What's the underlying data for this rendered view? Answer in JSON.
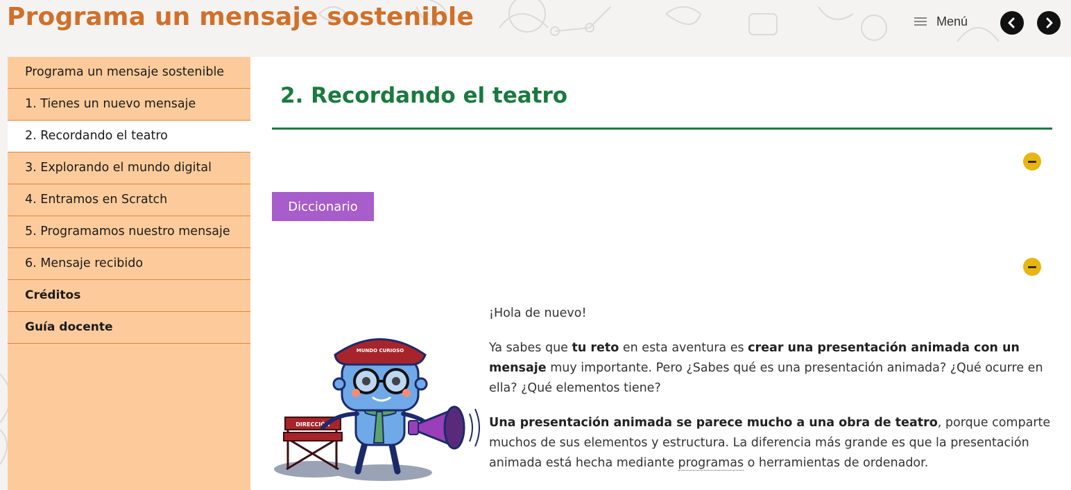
{
  "header": {
    "title": "Programa un mensaje sostenible",
    "menu_label": "Menú",
    "menu_icon": "hamburger-icon",
    "prev_icon": "chevron-left-icon",
    "next_icon": "chevron-right-icon"
  },
  "sidebar": {
    "items": [
      {
        "label": "Programa un mensaje sostenible"
      },
      {
        "label": "1. Tienes un nuevo mensaje"
      },
      {
        "label": "2. Recordando el teatro"
      },
      {
        "label": "3. Explorando el mundo digital"
      },
      {
        "label": "4. Entramos en Scratch"
      },
      {
        "label": "5. Programamos nuestro mensaje"
      },
      {
        "label": "6. Mensaje recibido"
      },
      {
        "label": "Créditos"
      },
      {
        "label": "Guía docente"
      }
    ],
    "active_index": 2
  },
  "main": {
    "page_title": "2. Recordando el teatro",
    "dictionary_button": "Diccionario",
    "collapse_icon": "minus-circle-icon",
    "illustration_text": {
      "cap": "MUNDO CURIOSO",
      "chair": "DIRECCIÓN"
    },
    "paragraphs": {
      "greeting": "¡Hola de nuevo!",
      "p1": {
        "a": "Ya sabes que ",
        "b": "tu reto",
        "c": " en esta aventura es ",
        "d": "crear una presentación animada con un mensaje",
        "e": " muy importante. Pero ¿Sabes qué es una presentación animada? ¿Qué ocurre en ella? ¿Qué elementos tiene?"
      },
      "p2": {
        "a": "Una presentación animada se parece mucho a una obra de teatro",
        "b": ", porque comparte muchos de sus elementos y estructura. La diferencia más grande es que la presentación animada está hecha mediante ",
        "c": "programas",
        "d": " o herramientas de ordenador."
      }
    }
  },
  "colors": {
    "title_orange": "#d0702a",
    "sidebar_bg": "#fdcb9b",
    "heading_green": "#1a7a3e",
    "dictionary_purple": "#a75dcb",
    "collapse_yellow": "#e8b512"
  }
}
